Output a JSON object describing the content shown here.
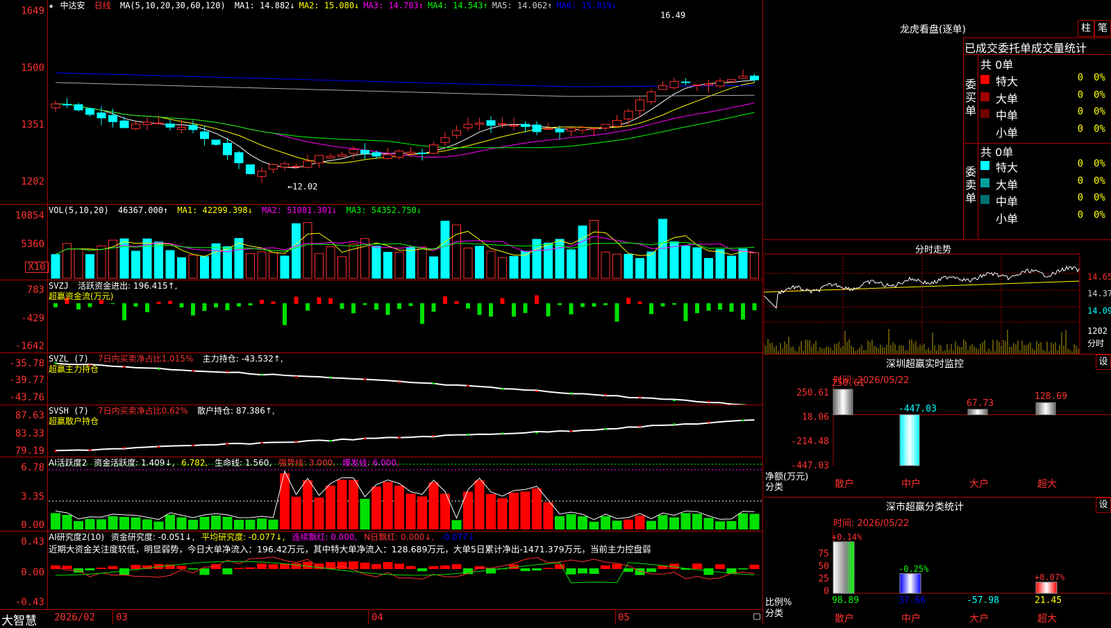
{
  "colors": {
    "up": "#ff3030",
    "down": "#00ffff",
    "grid": "#b00000",
    "axis_text": "#ff3030",
    "ma1": "#ffffff",
    "ma2": "#ffff00",
    "ma3": "#ff00ff",
    "ma4": "#00ff00",
    "ma5": "#aaaaaa",
    "ma6": "#0000ff"
  },
  "icons": {
    "star": "star-icon",
    "lock": "lock-icon"
  },
  "main": {
    "title_star": "★",
    "stock_name": "中达安",
    "period": "日线",
    "ma_params": "MA(5,10,20,30,60,120)",
    "mas": [
      {
        "label": "MA1:",
        "value": "14.882↓",
        "color": "#ffffff"
      },
      {
        "label": "MA2:",
        "value": "15.080↓",
        "color": "#ffff00"
      },
      {
        "label": "MA3:",
        "value": "14.703↑",
        "color": "#ff00ff"
      },
      {
        "label": "MA4:",
        "value": "14.543↑",
        "color": "#00ff00"
      },
      {
        "label": "MA5:",
        "value": "14.062↑",
        "color": "#cccccc"
      },
      {
        "label": "MA6:",
        "value": "15.019↓",
        "color": "#0000ff"
      }
    ],
    "y_ticks": [
      "1649",
      "1500",
      "1351",
      "1202"
    ],
    "high_label": "16.49",
    "low_label": "←12.02"
  },
  "vol": {
    "title": "VOL(5,10,20)",
    "value": "46367.000↑",
    "ma1": "MA1: 42299.398↓",
    "ma2": "MA2: 51081.301↓",
    "ma3": "MA3: 54352.750↓",
    "y_ticks": [
      "10854",
      "5360"
    ],
    "unit": "X10"
  },
  "svzj": {
    "title": "SVZJ",
    "desc": "活跃资金进出: 196.415↑,",
    "sub": "超赢资金流(万元)",
    "y_ticks": [
      "783",
      "-429",
      "-1642"
    ]
  },
  "svzl": {
    "title": "SVZL (7)",
    "ratio": "7日内买卖净占比1.015%",
    "hold": "主力持仓: -43.532↑,",
    "sub": "超赢主力持仓",
    "y_ticks": [
      "-35.78",
      "-39.77",
      "-43.76"
    ]
  },
  "svsh": {
    "title": "SVSH (7)",
    "ratio": "7日内买卖净占比0.62%",
    "hold": "散户持仓: 87.386↑,",
    "sub": "超赢散户持仓",
    "y_ticks": [
      "87.63",
      "83.33",
      "79.19"
    ]
  },
  "ai1": {
    "title": "AI活跃度2",
    "a": "资金活跃度: 1.409↓,",
    "b": "6.782,",
    "c": "生命线: 1.560,",
    "d": "强势线: 3.000,",
    "e": "爆发线: 6.000,",
    "y_ticks": [
      "6.78",
      "3.35",
      "0.00"
    ]
  },
  "ai2": {
    "title": "AI研究度2(10)",
    "a": "资金研究度: -0.051↓,",
    "b": "平均研究度: -0.077↓,",
    "c": "连续飘红: 0.000,",
    "d": "N日飘红: 0.000↓,",
    "e": "-0.077↓",
    "comment": "近期大资金关注度较低，明显弱势，今日大单净流入：196.42万元，其中特大单净流入：128.689万元，大单5日累计净出-1471.379万元，当前主力控盘弱",
    "y_ticks": [
      "0.43",
      "0.00",
      "-0.43"
    ]
  },
  "bottom": {
    "brand": "大智慧",
    "dates": [
      "2026/02",
      "03",
      "04",
      "05"
    ]
  },
  "dragon": {
    "title": "龙虎看盘(逐单)",
    "btn_col": "柱",
    "btn_pen": "笔",
    "tabs": [
      "已成交",
      "委托单",
      "成交量统计"
    ],
    "buy_label": "委买单",
    "sell_label": "委卖单",
    "buy": {
      "total": "共 0单",
      "rows": [
        {
          "name": "特大",
          "count": "0",
          "pct": "0%",
          "color": "#ff0000"
        },
        {
          "name": "大单",
          "count": "0",
          "pct": "0%",
          "color": "#a00000"
        },
        {
          "name": "中单",
          "count": "0",
          "pct": "0%",
          "color": "#700000"
        },
        {
          "name": "小单",
          "count": "0",
          "pct": "0%",
          "color": "#000000"
        }
      ]
    },
    "sell": {
      "total": "共 0单",
      "rows": [
        {
          "name": "特大",
          "count": "0",
          "pct": "0%",
          "color": "#00ffff"
        },
        {
          "name": "大单",
          "count": "0",
          "pct": "0%",
          "color": "#00a0a0"
        },
        {
          "name": "中单",
          "count": "0",
          "pct": "0%",
          "color": "#007070"
        },
        {
          "name": "小单",
          "count": "0",
          "pct": "0%",
          "color": "#000000"
        }
      ]
    }
  },
  "minute": {
    "title": "分时走势",
    "prices": [
      "14.65",
      "14.37",
      "14.09"
    ],
    "vol": "1202",
    "vol_unit": "分时"
  },
  "sz_monitor": {
    "title": "深圳超赢实时监控",
    "set": "设",
    "time": "时间: 2026/05/22",
    "y_ticks": [
      "250.61",
      "18.06",
      "-214.48",
      "-447.03"
    ],
    "ylabel": "净额(万元)",
    "xlabel": "分类",
    "cats": [
      "散户",
      "中户",
      "大户",
      "超大"
    ],
    "values": [
      "250.61",
      "-447.03",
      "67.73",
      "128.69"
    ],
    "nums": [
      250.61,
      -447.03,
      67.73,
      128.69
    ]
  },
  "sz_class": {
    "title": "深市超赢分类统计",
    "set": "设",
    "time": "时间: 2026/05/22",
    "y_ticks": [
      "75",
      "50",
      "25",
      "0"
    ],
    "ylabel": "比例%",
    "xlabel": "分类",
    "cats": [
      "散户",
      "中户",
      "大户",
      "超大"
    ],
    "top_labels": [
      "+0.14%",
      "-0.25%",
      "",
      "+0.07%"
    ],
    "bottom_vals": [
      "98.89",
      "37.66",
      "-57.98",
      "21.45"
    ],
    "nums": [
      98.89,
      37.66,
      -57.98,
      21.45
    ]
  }
}
